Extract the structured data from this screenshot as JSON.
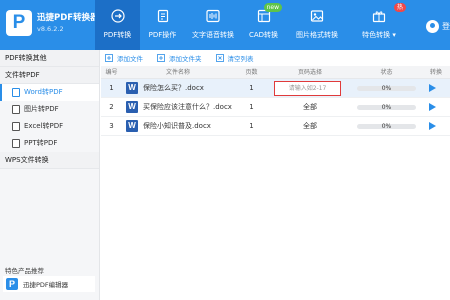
{
  "app": {
    "title": "迅捷PDF转换器",
    "version": "v8.6.2.2",
    "login_label": "登录"
  },
  "nav": {
    "items": [
      {
        "label": "PDF转换",
        "icon": "pdf-convert-icon",
        "active": true
      },
      {
        "label": "PDF操作",
        "icon": "pdf-operation-icon",
        "active": false
      },
      {
        "label": "文字语音转换",
        "icon": "audio-wave-icon",
        "active": false
      },
      {
        "label": "CAD转换",
        "icon": "cad-icon",
        "active": false,
        "badge": "new"
      },
      {
        "label": "图片格式转换",
        "icon": "image-icon",
        "active": false
      },
      {
        "label": "特色转换",
        "icon": "gift-icon",
        "active": false,
        "badge": "热",
        "dropdown": true
      }
    ]
  },
  "sidebar": {
    "groups": [
      {
        "label": "PDF转换其他"
      },
      {
        "label": "文件转PDF"
      }
    ],
    "items": [
      {
        "label": "Word转PDF",
        "active": true
      },
      {
        "label": "图片转PDF",
        "active": false
      },
      {
        "label": "Excel转PDF",
        "active": false
      },
      {
        "label": "PPT转PDF",
        "active": false
      }
    ],
    "group_wps": "WPS文件转换",
    "promo_title": "特色产品推荐",
    "promo_app": "迅捷PDF编辑器"
  },
  "toolbar": {
    "add_file": "添加文件",
    "add_folder": "添加文件夹",
    "clear_list": "清空列表"
  },
  "table": {
    "headers": [
      "编号",
      "文件名称",
      "页数",
      "页码选择",
      "状态",
      "转换"
    ],
    "rows": [
      {
        "no": "1",
        "name": "保险怎么买？.docx",
        "pages": "1",
        "range_placeholder": "请输入如2-17",
        "range_value": "",
        "status": "0%",
        "progress": 0,
        "selected": true
      },
      {
        "no": "2",
        "name": "买保险应该注意什么？.docx",
        "pages": "1",
        "range_placeholder": "",
        "range_value": "全部",
        "status": "0%",
        "progress": 0,
        "selected": false
      },
      {
        "no": "3",
        "name": "保险小知识普及.docx",
        "pages": "1",
        "range_placeholder": "",
        "range_value": "全部",
        "status": "0%",
        "progress": 0,
        "selected": false
      }
    ]
  },
  "colors": {
    "brand": "#2a8ee8",
    "nav_active": "#1c6fc7",
    "highlight_border": "#e03b3b",
    "word_icon": "#2a5fb0"
  }
}
